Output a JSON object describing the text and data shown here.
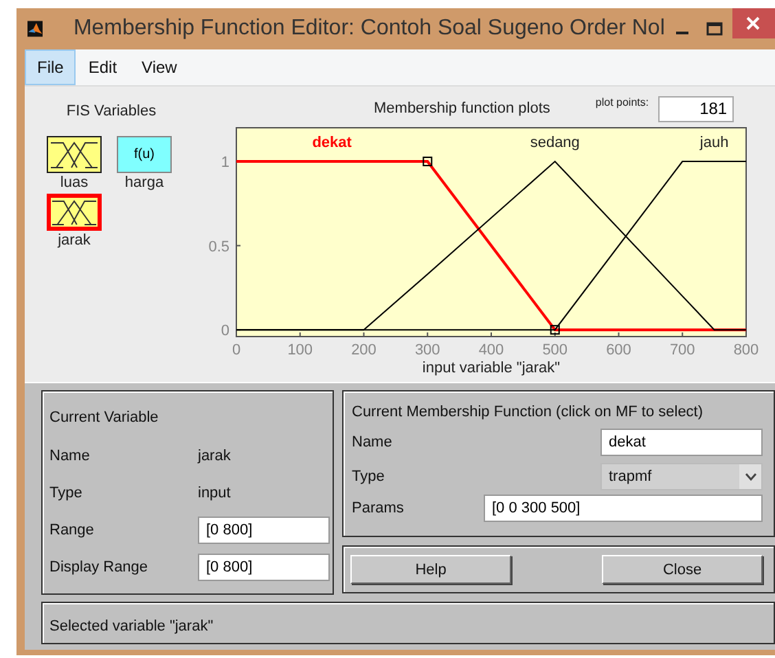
{
  "window": {
    "title": "Membership Function Editor: Contoh Soal Sugeno Order Nol"
  },
  "menu": [
    {
      "label": "File",
      "selected": true
    },
    {
      "label": "Edit",
      "selected": false
    },
    {
      "label": "View",
      "selected": false
    }
  ],
  "fis_variables": {
    "title": "FIS Variables",
    "items": [
      {
        "name": "luas",
        "kind": "input",
        "selected": false
      },
      {
        "name": "harga",
        "kind": "output",
        "icon_text": "f(u)",
        "selected": false
      },
      {
        "name": "jarak",
        "kind": "input",
        "selected": true
      }
    ]
  },
  "plot": {
    "title": "Membership function plots",
    "plot_points_label": "plot points:",
    "plot_points": "181",
    "chart_data": {
      "type": "line",
      "xlabel": "input variable \"jarak\"",
      "x": [
        0,
        200,
        300,
        500,
        700,
        750,
        800
      ],
      "xlim": [
        0,
        800
      ],
      "ylim": [
        -0.04,
        1.2
      ],
      "xticks": [
        0,
        100,
        200,
        300,
        400,
        500,
        600,
        700,
        800
      ],
      "yticks": [
        0,
        {
          "value": 0.5,
          "label": "0.5"
        },
        1
      ],
      "series": [
        {
          "name": "dekat",
          "color": "#ff0000",
          "values": [
            1,
            1,
            1,
            0,
            0,
            0,
            0
          ]
        },
        {
          "name": "sedang",
          "color": "#000000",
          "values": [
            0,
            0,
            0.33,
            1,
            0.2,
            0,
            0
          ]
        },
        {
          "name": "jauh",
          "color": "#000000",
          "values": [
            0,
            0,
            0,
            0,
            1,
            1,
            1
          ]
        }
      ]
    }
  },
  "current_variable": {
    "title": "Current Variable",
    "name_label": "Name",
    "name": "jarak",
    "type_label": "Type",
    "type": "input",
    "range_label": "Range",
    "range": "[0 800]",
    "display_range_label": "Display Range",
    "display_range": "[0 800]"
  },
  "current_mf": {
    "title": "Current Membership Function (click on MF to select)",
    "name_label": "Name",
    "name": "dekat",
    "type_label": "Type",
    "type": "trapmf",
    "params_label": "Params",
    "params": "[0 0 300 500]"
  },
  "buttons": [
    "Help",
    "Close"
  ],
  "status": "Selected variable \"jarak\""
}
